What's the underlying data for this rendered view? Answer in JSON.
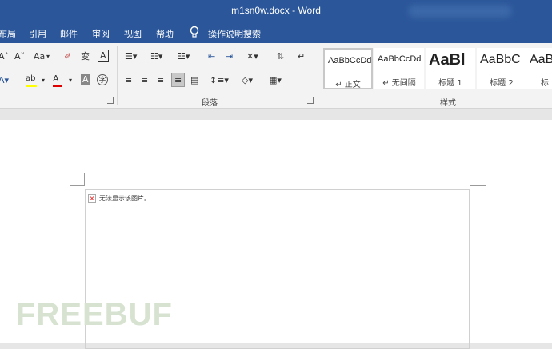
{
  "window": {
    "title": "m1sn0w.docx  -  Word"
  },
  "menu": {
    "tabs": [
      "布局",
      "引用",
      "邮件",
      "审阅",
      "视图",
      "帮助"
    ],
    "tell_me": "操作说明搜索"
  },
  "ribbon": {
    "font_group": {
      "font_size_case": "Aa",
      "phonetic": "变",
      "char_border": "A",
      "highlight": "ab",
      "font_color": "A",
      "shading": "A",
      "enclose": "字"
    },
    "paragraph": {
      "label": "段落"
    },
    "styles": {
      "label": "样式",
      "items": [
        {
          "sample": "AaBbCcDd",
          "name": "↵ 正文"
        },
        {
          "sample": "AaBbCcDd",
          "name": "↵ 无间隔"
        },
        {
          "sample": "AaBl",
          "name": "标题 1"
        },
        {
          "sample": "AaBbC",
          "name": "标题 2"
        },
        {
          "sample": "AaB",
          "name": "标题"
        }
      ]
    }
  },
  "document": {
    "broken_image_text": "无法显示该图片。"
  },
  "watermark": "FREEBUF",
  "colors": {
    "title_bar": "#2b579a",
    "ribbon": "#f3f3f3",
    "highlight_yellow": "#ffff00",
    "font_red": "#e00000"
  }
}
